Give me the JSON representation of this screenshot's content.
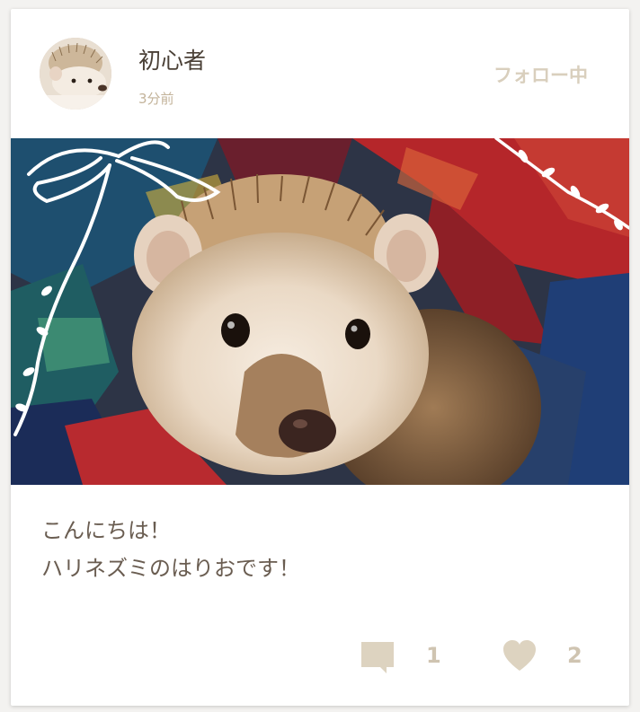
{
  "post": {
    "user": {
      "name": "初心者",
      "time_ago": "3分前"
    },
    "follow_label": "フォロー中",
    "caption_lines": [
      "こんにちは！",
      "ハリネズミのはりおです！"
    ],
    "comments_count": "1",
    "likes_count": "2",
    "icons": {
      "comment": "comment-bubble-icon",
      "like": "heart-icon"
    },
    "colors": {
      "accent": "#d9cfbd",
      "icon": "#ddd3c0",
      "text": "#6a5d51"
    }
  }
}
